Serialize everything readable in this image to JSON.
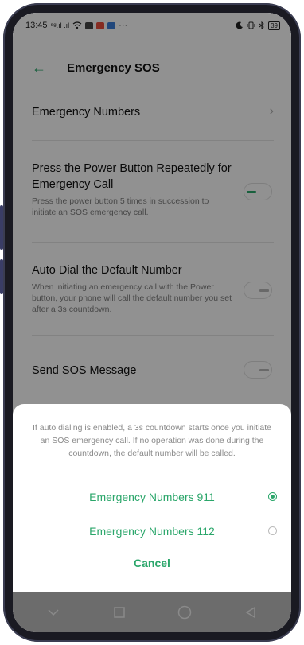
{
  "status_bar": {
    "time": "13:45",
    "signal_text": "⁵ᵍ.ıl .ıl",
    "extra_text": "···",
    "battery": "39",
    "right_icons": [
      "moon-icon",
      "vibrate-icon",
      "bluetooth-icon"
    ]
  },
  "header": {
    "title": "Emergency SOS"
  },
  "settings": {
    "emergency_numbers": {
      "title": "Emergency Numbers"
    },
    "power_button": {
      "title": "Press the Power Button Repeatedly for Emergency Call",
      "subtitle": "Press the power button 5 times in succession to initiate an SOS emergency call.",
      "enabled": true
    },
    "auto_dial": {
      "title": "Auto Dial the Default Number",
      "subtitle": "When initiating an emergency call with the Power button, your phone will call the default number you set after a 3s countdown.",
      "enabled": false
    },
    "send_sos": {
      "title": "Send SOS Message",
      "enabled": false
    }
  },
  "sheet": {
    "message": "If auto dialing is enabled, a 3s countdown starts once you initiate an SOS emergency call. If no operation was done during the countdown, the default number will be called.",
    "options": [
      {
        "label": "Emergency Numbers 911",
        "selected": true
      },
      {
        "label": "Emergency Numbers 112",
        "selected": false
      }
    ],
    "cancel_label": "Cancel"
  },
  "colors": {
    "accent": "#2aa66a",
    "overlay": "#6c6c6c"
  }
}
